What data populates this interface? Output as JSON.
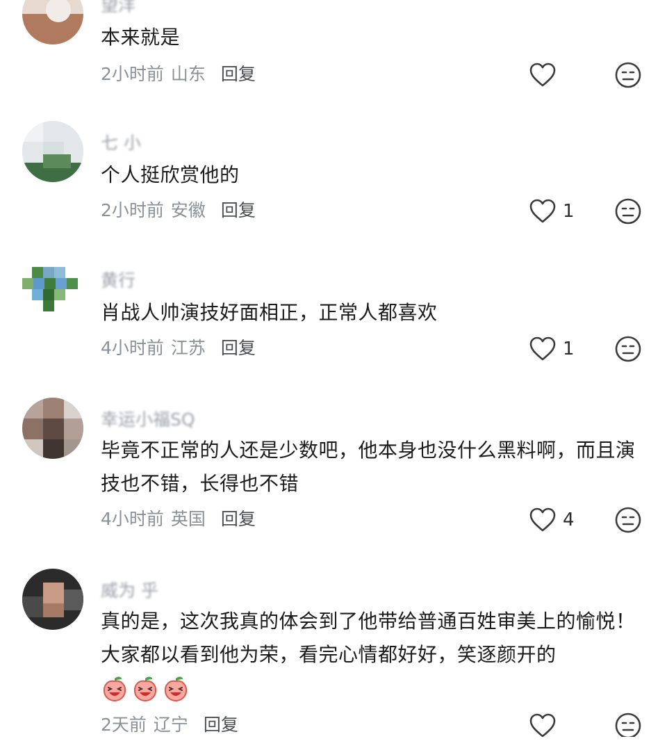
{
  "comments": [
    {
      "username": "望洋",
      "text": "本来就是",
      "time": "2小时前",
      "location": "山东",
      "reply_label": "回复",
      "likes": ""
    },
    {
      "username": "七 小",
      "text": "个人挺欣赏他的",
      "time": "2小时前",
      "location": "安徽",
      "reply_label": "回复",
      "likes": "1"
    },
    {
      "username": "黄行",
      "text": "肖战人帅演技好面相正，正常人都喜欢",
      "time": "4小时前",
      "location": "江苏",
      "reply_label": "回复",
      "likes": "1"
    },
    {
      "username": "幸运小福SQ",
      "text": "毕竟不正常的人还是少数吧，他本身也没什么黑料啊，而且演技也不错，长得也不错",
      "time": "4小时前",
      "location": "英国",
      "reply_label": "回复",
      "likes": "4"
    },
    {
      "username": "威为 乎",
      "text": "真的是，这次我真的体会到了他带给普通百姓审美上的愉悦！大家都以看到他为荣，看完心情都好好，笑逐颜开的",
      "time": "2天前",
      "location": "辽宁",
      "reply_label": "回复",
      "likes": ""
    }
  ],
  "icons": {
    "like": "heart-outline-icon",
    "dislike": "neutral-face-icon",
    "sticker": "laughing-peach-sticker"
  },
  "colors": {
    "text": "#1b1b1b",
    "meta": "#8a8f98",
    "reply": "#4a4d53",
    "icon": "#3a3a3a"
  }
}
